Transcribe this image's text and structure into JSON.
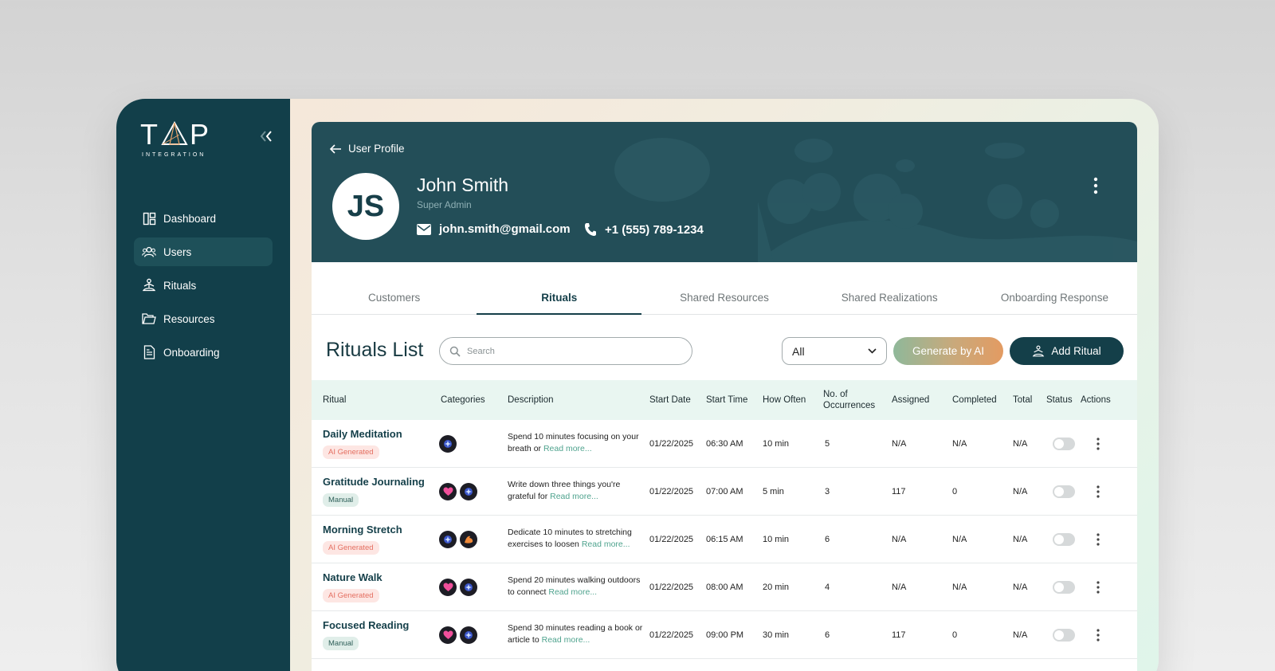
{
  "brand": {
    "logo_main": "T P",
    "logo_sub": "INTEGRATION"
  },
  "sidebar": {
    "items": [
      {
        "label": "Dashboard",
        "icon": "dashboard-icon",
        "active": false
      },
      {
        "label": "Users",
        "icon": "users-icon",
        "active": true
      },
      {
        "label": "Rituals",
        "icon": "rituals-icon",
        "active": false
      },
      {
        "label": "Resources",
        "icon": "folder-icon",
        "active": false
      },
      {
        "label": "Onboarding",
        "icon": "document-icon",
        "active": false
      }
    ]
  },
  "profile": {
    "back_label": "User Profile",
    "initials": "JS",
    "name": "John Smith",
    "role": "Super Admin",
    "email": "john.smith@gmail.com",
    "phone": "+1 (555) 789-1234"
  },
  "tabs": [
    {
      "label": "Customers",
      "active": false
    },
    {
      "label": "Rituals",
      "active": true
    },
    {
      "label": "Shared Resources",
      "active": false
    },
    {
      "label": "Shared Realizations",
      "active": false
    },
    {
      "label": "Onboarding Response",
      "active": false
    }
  ],
  "toolbar": {
    "title": "Rituals List",
    "search_placeholder": "Search",
    "filter_value": "All",
    "generate_label": "Generate by AI",
    "add_label": "Add Ritual"
  },
  "table": {
    "columns": [
      "Ritual",
      "Categories",
      "Description",
      "Start Date",
      "Start Time",
      "How Often",
      "No. of Occurrences",
      "Assigned",
      "Completed",
      "Total",
      "Status",
      "Actions"
    ],
    "rows": [
      {
        "name": "Daily Meditation",
        "badge": "AI Generated",
        "badge_type": "ai",
        "categories": [
          "spirit"
        ],
        "desc": "Spend 10 minutes focusing on your breath or",
        "read_more": "Read more...",
        "start_date": "01/22/2025",
        "start_time": "06:30 AM",
        "how_often": "10 min",
        "occurrences": "5",
        "assigned": "N/A",
        "completed": "N/A",
        "total": "N/A",
        "status": false
      },
      {
        "name": "Gratitude Journaling",
        "badge": "Manual",
        "badge_type": "manual",
        "categories": [
          "heart",
          "spirit"
        ],
        "desc": "Write down three things you're grateful for",
        "read_more": "Read more...",
        "start_date": "01/22/2025",
        "start_time": "07:00 AM",
        "how_often": "5 min",
        "occurrences": "3",
        "assigned": "117",
        "completed": "0",
        "total": "N/A",
        "status": false
      },
      {
        "name": "Morning Stretch",
        "badge": "AI Generated",
        "badge_type": "ai",
        "categories": [
          "spirit",
          "muscle"
        ],
        "desc": "Dedicate 10 minutes to stretching exercises to loosen",
        "read_more": "Read more...",
        "start_date": "01/22/2025",
        "start_time": "06:15 AM",
        "how_often": "10 min",
        "occurrences": "6",
        "assigned": "N/A",
        "completed": "N/A",
        "total": "N/A",
        "status": false
      },
      {
        "name": "Nature Walk",
        "badge": "AI Generated",
        "badge_type": "ai",
        "categories": [
          "heart",
          "spirit"
        ],
        "desc": "Spend 20 minutes walking outdoors to connect",
        "read_more": "Read more...",
        "start_date": "01/22/2025",
        "start_time": "08:00 AM",
        "how_often": "20 min",
        "occurrences": "4",
        "assigned": "N/A",
        "completed": "N/A",
        "total": "N/A",
        "status": false
      },
      {
        "name": "Focused Reading",
        "badge": "Manual",
        "badge_type": "manual",
        "categories": [
          "heart",
          "spirit"
        ],
        "desc": "Spend 30 minutes reading a book or article to",
        "read_more": "Read more...",
        "start_date": "01/22/2025",
        "start_time": "09:00 PM",
        "how_often": "30 min",
        "occurrences": "6",
        "assigned": "117",
        "completed": "0",
        "total": "N/A",
        "status": false
      }
    ]
  },
  "colors": {
    "sidebar": "#123f4a",
    "header": "#234e58",
    "accent": "#4fa38e",
    "table_head": "#e9f6f1"
  }
}
